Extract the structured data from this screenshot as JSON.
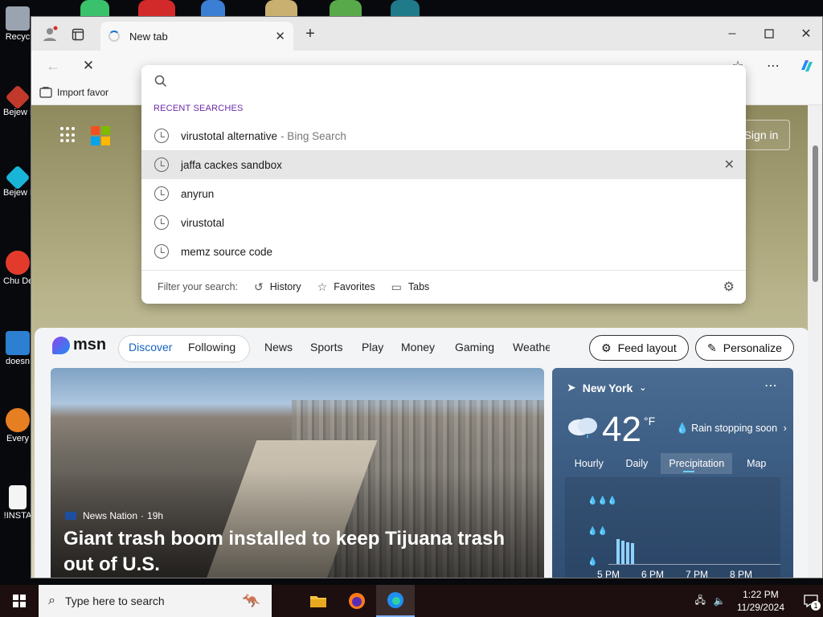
{
  "desktop": {
    "icons": [
      {
        "label": "Recyc"
      },
      {
        "label": "Bejew Del"
      },
      {
        "label": "Bejew Del"
      },
      {
        "label": "Chu Del"
      },
      {
        "label": "doesn"
      },
      {
        "label": "Every"
      },
      {
        "label": "!INSTA"
      }
    ]
  },
  "browser": {
    "tab_title": "New tab",
    "favbar_label": "Import favor",
    "sign_in": "Sign in"
  },
  "suggestions": {
    "search_placeholder": "",
    "header": "RECENT SEARCHES",
    "items": [
      {
        "text": "virustotal alternative",
        "suffix": "- Bing Search"
      },
      {
        "text": "jaffa cackes sandbox",
        "suffix": ""
      },
      {
        "text": "anyrun",
        "suffix": ""
      },
      {
        "text": "virustotal",
        "suffix": ""
      },
      {
        "text": "memz source code",
        "suffix": ""
      }
    ],
    "filter_label": "Filter your search:",
    "filters": [
      "History",
      "Favorites",
      "Tabs"
    ]
  },
  "feed": {
    "logo": "msn",
    "tabs": [
      "Discover",
      "Following",
      "News",
      "Sports",
      "Play",
      "Money",
      "Gaming",
      "Weathe"
    ],
    "feed_layout": "Feed layout",
    "personalize": "Personalize",
    "hero": {
      "source": "News Nation",
      "age": "19h",
      "headline": "Giant trash boom installed to keep Tijuana trash out of U.S."
    },
    "weather": {
      "location": "New York",
      "temperature": "42",
      "unit": "°F",
      "condition": "Rain stopping soon",
      "tabs": [
        "Hourly",
        "Daily",
        "Precipitation",
        "Map"
      ],
      "times": [
        "5 PM",
        "6 PM",
        "7 PM",
        "8 PM"
      ],
      "bars": [
        0.62,
        0.58,
        0.54,
        0.52
      ]
    }
  },
  "taskbar": {
    "search_placeholder": "Type here to search",
    "time": "1:22 PM",
    "date": "11/29/2024",
    "notifications": "1"
  }
}
